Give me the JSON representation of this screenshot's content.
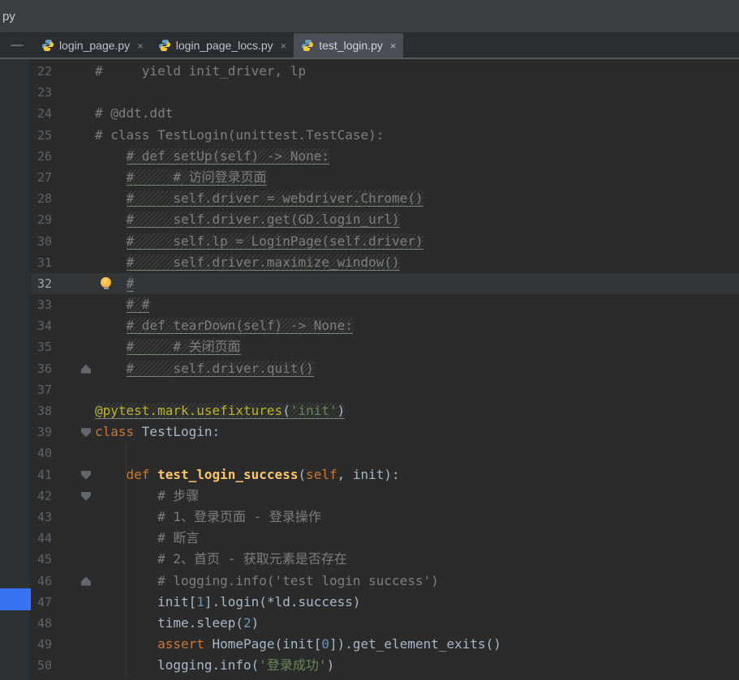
{
  "window": {
    "top_left_label": "py"
  },
  "tab_bar": {
    "minimize_glyph": "—",
    "close_glyph": "×",
    "tabs": [
      {
        "label": "login_page.py",
        "icon": "python-file-icon",
        "active": false
      },
      {
        "label": "login_page_locs.py",
        "icon": "python-file-icon",
        "active": false
      },
      {
        "label": "test_login.py",
        "icon": "python-file-icon",
        "active": true
      }
    ]
  },
  "colors": {
    "editor_background": "#2b2b2b",
    "current_line": "#333537",
    "accent_blue": "#3574f0",
    "comment": "#7e7e7e",
    "keyword": "#cc7832",
    "string": "#6a8759",
    "number": "#6897bb",
    "decorator": "#bbb529",
    "function_name": "#ffc66d"
  },
  "editor": {
    "first_line_number": 22,
    "current_line_number": 32,
    "lines": [
      {
        "num": 22,
        "segments": [
          {
            "t": "#     yield init_driver, lp",
            "c": "comment"
          }
        ]
      },
      {
        "num": 23,
        "segments": []
      },
      {
        "num": 24,
        "segments": [
          {
            "t": "# @ddt.ddt",
            "c": "comment"
          }
        ]
      },
      {
        "num": 25,
        "segments": [
          {
            "t": "# class TestLogin(unittest.TestCase):",
            "c": "comment"
          }
        ]
      },
      {
        "num": 26,
        "segments": [
          {
            "t": "    ",
            "c": "plain"
          },
          {
            "t": "# def setUp(self) -> None:",
            "c": "comment",
            "hatch": true
          }
        ]
      },
      {
        "num": 27,
        "segments": [
          {
            "t": "    ",
            "c": "plain"
          },
          {
            "t": "#     # 访问登录页面",
            "c": "comment",
            "hatch": true
          }
        ]
      },
      {
        "num": 28,
        "segments": [
          {
            "t": "    ",
            "c": "plain"
          },
          {
            "t": "#     self.driver = webdriver.Chrome()",
            "c": "comment",
            "hatch": true
          }
        ]
      },
      {
        "num": 29,
        "segments": [
          {
            "t": "    ",
            "c": "plain"
          },
          {
            "t": "#     self.driver.get(GD.login_url)",
            "c": "comment",
            "hatch": true
          }
        ]
      },
      {
        "num": 30,
        "segments": [
          {
            "t": "    ",
            "c": "plain"
          },
          {
            "t": "#     self.lp = LoginPage(self.driver)",
            "c": "comment",
            "hatch": true
          }
        ]
      },
      {
        "num": 31,
        "segments": [
          {
            "t": "    ",
            "c": "plain"
          },
          {
            "t": "#     self.driver.maximize_window()",
            "c": "comment",
            "hatch": true
          }
        ]
      },
      {
        "num": 32,
        "current": true,
        "bulb": true,
        "segments": [
          {
            "t": "    ",
            "c": "plain"
          },
          {
            "t": "#",
            "c": "comment",
            "hatch": true
          }
        ]
      },
      {
        "num": 33,
        "segments": [
          {
            "t": "    ",
            "c": "plain"
          },
          {
            "t": "# #",
            "c": "comment",
            "hatch": true
          }
        ]
      },
      {
        "num": 34,
        "segments": [
          {
            "t": "    ",
            "c": "plain"
          },
          {
            "t": "# def tearDown(self) -> None:",
            "c": "comment",
            "hatch": true
          }
        ]
      },
      {
        "num": 35,
        "segments": [
          {
            "t": "    ",
            "c": "plain"
          },
          {
            "t": "#     # 关闭页面",
            "c": "comment",
            "hatch": true
          }
        ]
      },
      {
        "num": 36,
        "fold": "end",
        "segments": [
          {
            "t": "    ",
            "c": "plain"
          },
          {
            "t": "#     self.driver.quit()",
            "c": "comment",
            "hatch": true
          }
        ]
      },
      {
        "num": 37,
        "segments": []
      },
      {
        "num": 38,
        "segments": [
          {
            "t": "@pytest.mark.usefixtures",
            "c": "deco",
            "hatch": true
          },
          {
            "t": "(",
            "c": "plain",
            "hatch": true
          },
          {
            "t": "'init'",
            "c": "str",
            "hatch": true
          },
          {
            "t": ")",
            "c": "plain",
            "hatch": true
          }
        ]
      },
      {
        "num": 39,
        "fold": "start",
        "segments": [
          {
            "t": "class ",
            "c": "kw"
          },
          {
            "t": "TestLogin:",
            "c": "plain"
          }
        ]
      },
      {
        "num": 40,
        "segments": []
      },
      {
        "num": 41,
        "fold": "start",
        "segments": [
          {
            "t": "    ",
            "c": "plain"
          },
          {
            "t": "def ",
            "c": "kw"
          },
          {
            "t": "test_login_success",
            "c": "fn"
          },
          {
            "t": "(",
            "c": "plain"
          },
          {
            "t": "self",
            "c": "selfp"
          },
          {
            "t": ", init):",
            "c": "plain"
          }
        ]
      },
      {
        "num": 42,
        "fold": "start",
        "segments": [
          {
            "t": "        ",
            "c": "plain"
          },
          {
            "t": "# 步骤",
            "c": "comment"
          }
        ]
      },
      {
        "num": 43,
        "segments": [
          {
            "t": "        ",
            "c": "plain"
          },
          {
            "t": "# 1、登录页面 - 登录操作",
            "c": "comment"
          }
        ]
      },
      {
        "num": 44,
        "segments": [
          {
            "t": "        ",
            "c": "plain"
          },
          {
            "t": "# 断言",
            "c": "comment"
          }
        ]
      },
      {
        "num": 45,
        "segments": [
          {
            "t": "        ",
            "c": "plain"
          },
          {
            "t": "# 2、首页 - 获取元素是否存在",
            "c": "comment"
          }
        ]
      },
      {
        "num": 46,
        "fold": "end",
        "segments": [
          {
            "t": "        ",
            "c": "plain"
          },
          {
            "t": "# logging.info('test login success')",
            "c": "comment"
          }
        ]
      },
      {
        "num": 47,
        "segments": [
          {
            "t": "        init[",
            "c": "plain"
          },
          {
            "t": "1",
            "c": "num"
          },
          {
            "t": "].login(*ld.success)",
            "c": "plain"
          }
        ]
      },
      {
        "num": 48,
        "segments": [
          {
            "t": "        time.sleep(",
            "c": "plain"
          },
          {
            "t": "2",
            "c": "num"
          },
          {
            "t": ")",
            "c": "plain"
          }
        ]
      },
      {
        "num": 49,
        "segments": [
          {
            "t": "        ",
            "c": "plain"
          },
          {
            "t": "assert ",
            "c": "kw"
          },
          {
            "t": "HomePage(init[",
            "c": "plain"
          },
          {
            "t": "0",
            "c": "num"
          },
          {
            "t": "]).get_element_exits()",
            "c": "plain"
          }
        ]
      },
      {
        "num": 50,
        "segments": [
          {
            "t": "        logging.info(",
            "c": "plain"
          },
          {
            "t": "'登录成功'",
            "c": "str"
          },
          {
            "t": ")",
            "c": "plain"
          }
        ]
      }
    ]
  }
}
